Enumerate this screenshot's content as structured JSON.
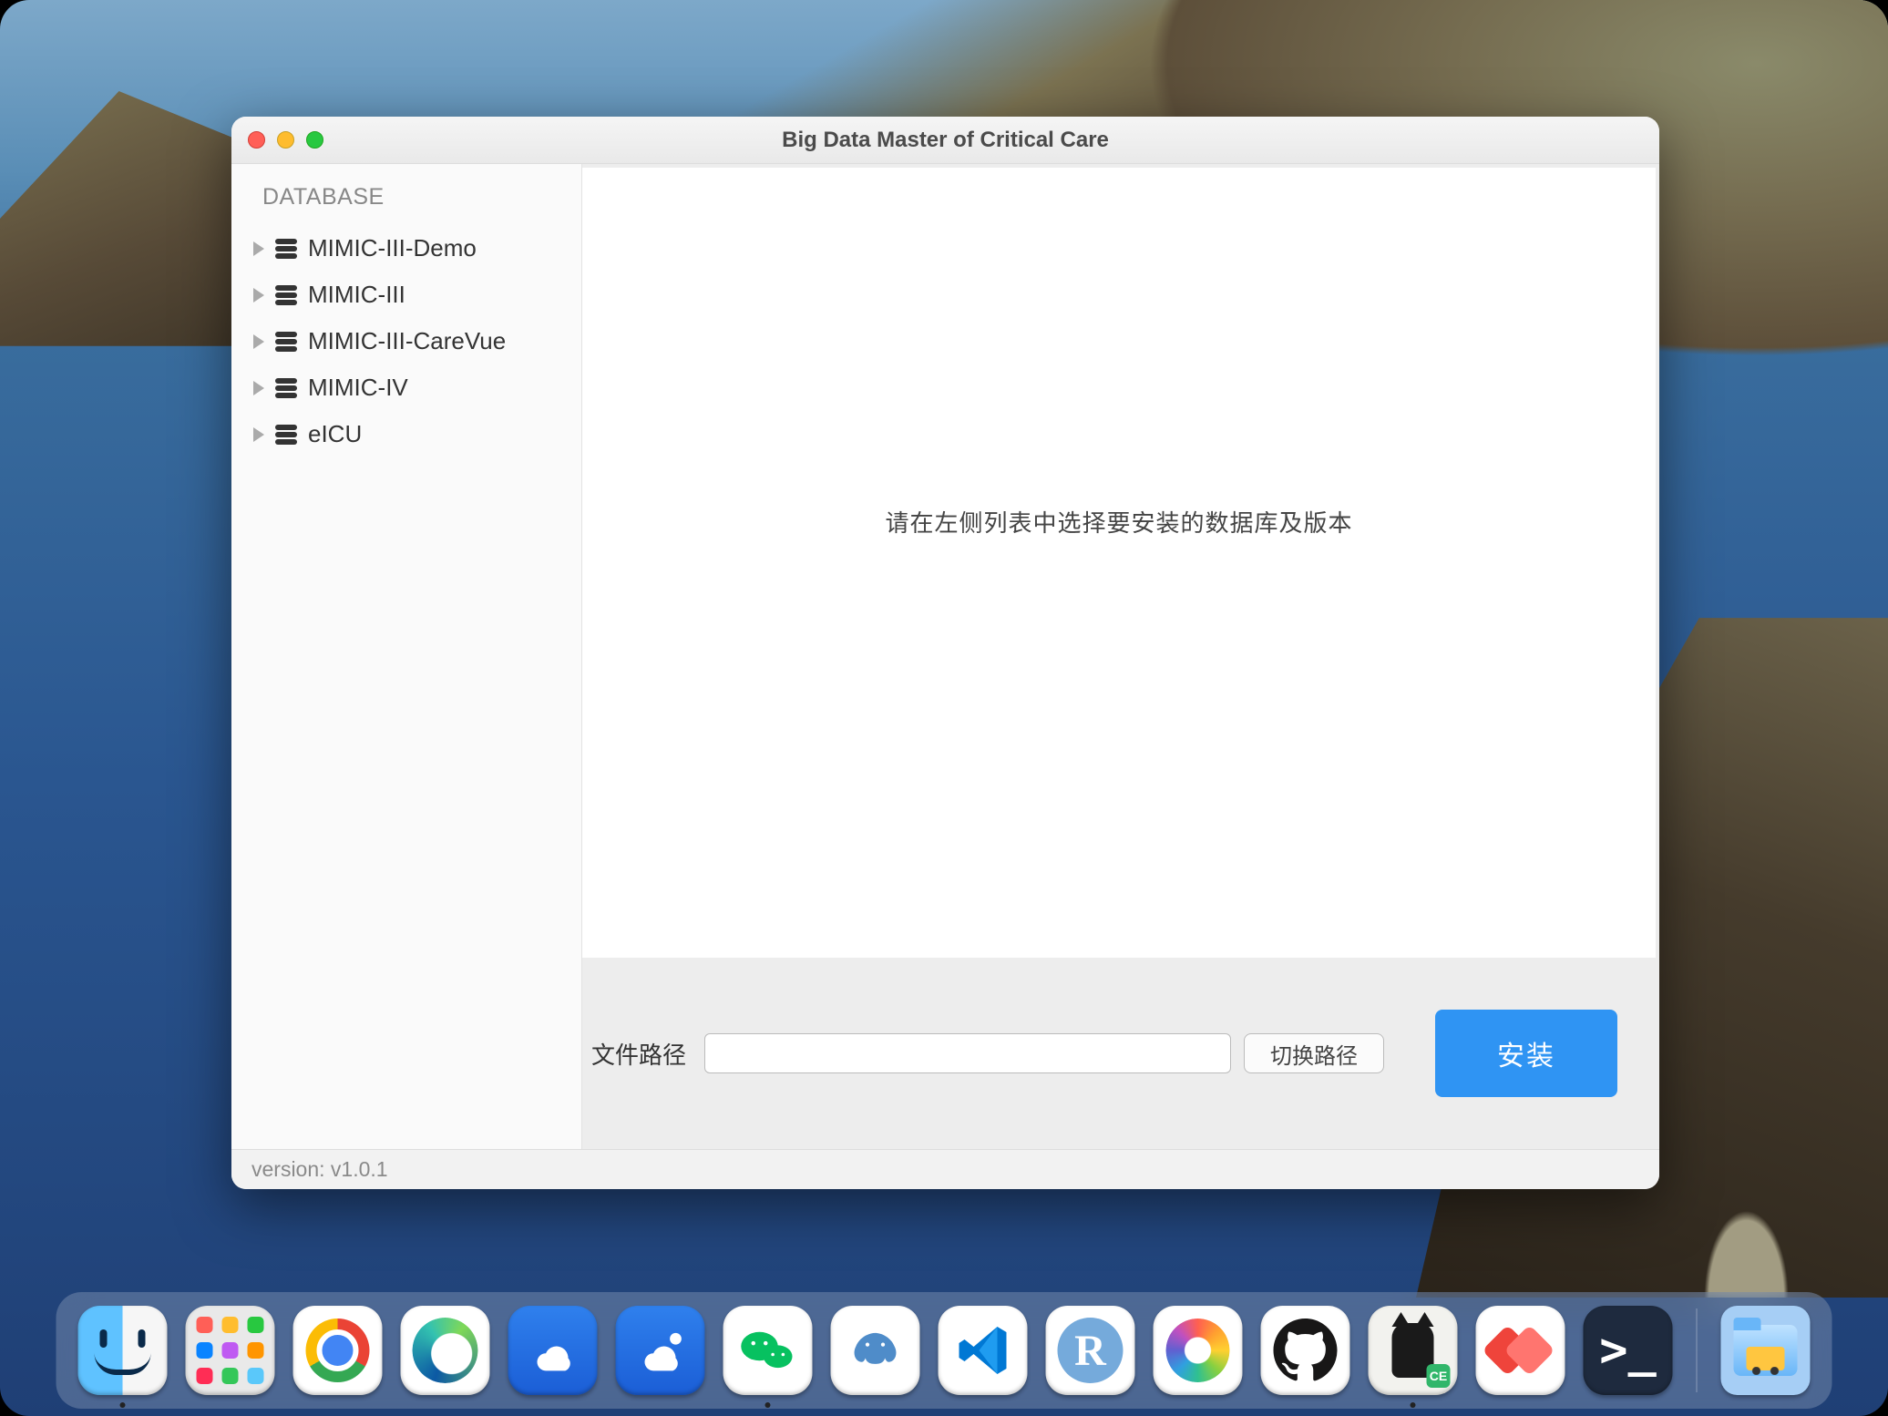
{
  "window": {
    "title": "Big Data Master of Critical Care"
  },
  "sidebar": {
    "header": "DATABASE",
    "items": [
      {
        "label": "MIMIC-III-Demo"
      },
      {
        "label": "MIMIC-III"
      },
      {
        "label": "MIMIC-III-CareVue"
      },
      {
        "label": "MIMIC-IV"
      },
      {
        "label": "eICU"
      }
    ]
  },
  "main": {
    "hint": "请在左侧列表中选择要安装的数据库及版本"
  },
  "footer": {
    "path_label": "文件路径",
    "path_value": "",
    "change_btn": "切换路径",
    "install_btn": "安装"
  },
  "statusbar": {
    "version": "version: v1.0.1"
  },
  "dock": {
    "items": [
      {
        "name": "finder",
        "running": true
      },
      {
        "name": "launchpad",
        "running": false
      },
      {
        "name": "chrome",
        "running": false
      },
      {
        "name": "edge",
        "running": false
      },
      {
        "name": "cloud-app-1",
        "running": false
      },
      {
        "name": "cloud-app-2",
        "running": false
      },
      {
        "name": "wechat",
        "running": true
      },
      {
        "name": "postgres",
        "running": false
      },
      {
        "name": "vscode",
        "running": false
      },
      {
        "name": "rstudio",
        "running": false
      },
      {
        "name": "photos",
        "running": false
      },
      {
        "name": "github-desktop",
        "running": false
      },
      {
        "name": "code-editor",
        "running": true
      },
      {
        "name": "anydesk",
        "running": false
      },
      {
        "name": "terminal",
        "running": false
      }
    ],
    "bear_badge": "CE"
  }
}
